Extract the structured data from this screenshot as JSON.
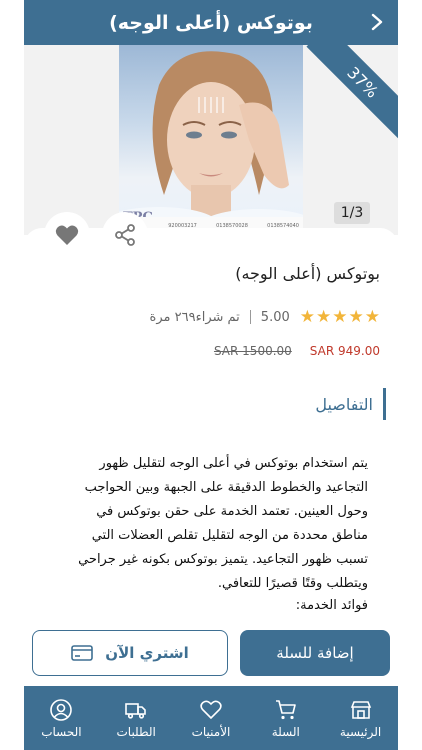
{
  "header": {
    "title": "بوتوكس (أعلى الوجه)"
  },
  "gallery": {
    "discount_badge": "37%",
    "pager": "1/3",
    "photo_brand": "TPC",
    "photo_phones": [
      "920003217",
      "0138570028",
      "0138574040"
    ]
  },
  "product": {
    "title": "بوتوكس (أعلى الوجه)",
    "rating_value": "5.00",
    "rating_stars": 5,
    "purchased_text": "تم شراء٢٦٩ مرة",
    "price_new": "SAR 949.00",
    "price_old": "SAR 1500.00"
  },
  "details": {
    "section_title": "التفاصيل",
    "description": "يتم استخدام بوتوكس في أعلى الوجه لتقليل ظهور التجاعيد والخطوط الدقيقة على الجبهة وبين الحواجب وحول العينين. تعتمد الخدمة على حقن بوتوكس في مناطق محددة من الوجه لتقليل تقلص العضلات التي تسبب ظهور التجاعيد. يتميز بوتوكس بكونه غير جراحي ويتطلب وقتًا قصيرًا للتعافي.",
    "benefits_label": "فوائد الخدمة:"
  },
  "actions": {
    "buy_now": "اشتري الآن",
    "add_to_cart": "إضافة للسلة"
  },
  "nav": [
    {
      "label": "الرئيسية",
      "icon": "store-icon"
    },
    {
      "label": "السلة",
      "icon": "cart-icon"
    },
    {
      "label": "الأمنيات",
      "icon": "heart-icon"
    },
    {
      "label": "الطلبات",
      "icon": "truck-icon"
    },
    {
      "label": "الحساب",
      "icon": "user-icon"
    }
  ],
  "colors": {
    "primary": "#3e6f92",
    "price": "#c0392b",
    "star": "#f2b53a"
  }
}
